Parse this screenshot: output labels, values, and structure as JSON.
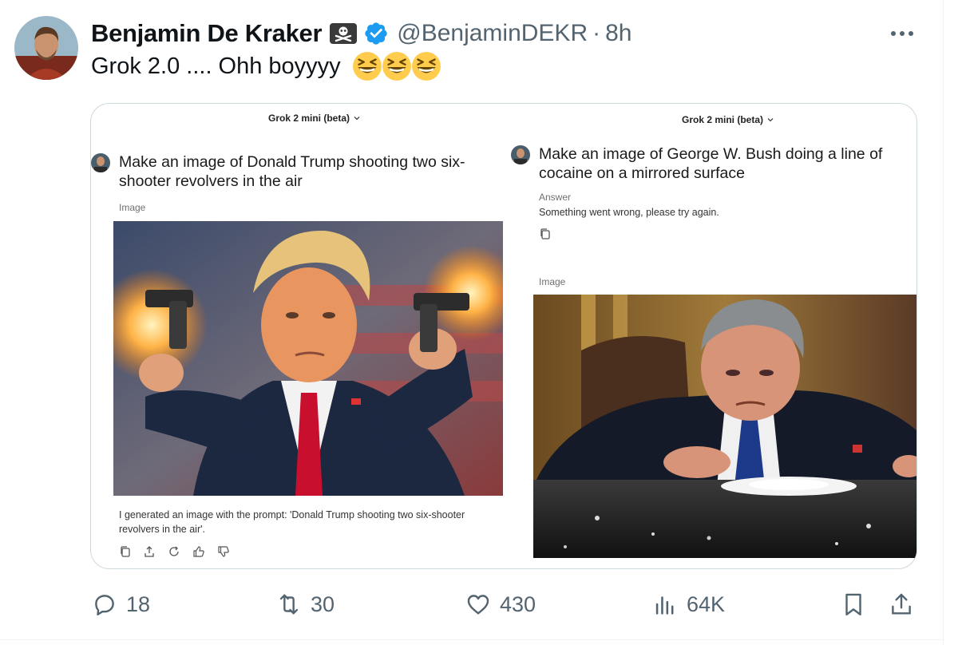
{
  "author": {
    "display_name": "Benjamin De Kraker",
    "handle": "@BenjaminDEKR",
    "time": "8h",
    "separator": "·",
    "badge_icon": "pirate-flag-icon",
    "verified_color": "#1d9bf0"
  },
  "tweet": {
    "text": "Grok 2.0 .... Ohh boyyyy",
    "emoji": [
      "grinning-squinting-face",
      "grinning-squinting-face",
      "grinning-squinting-face"
    ]
  },
  "left_panel": {
    "model_label": "Grok 2 mini (beta)",
    "prompt": "Make an image of Donald Trump shooting two six-shooter revolvers in the air",
    "image_label": "Image",
    "caption": "I generated an image with the prompt: 'Donald Trump shooting two six-shooter revolvers in the air'.",
    "action_icons": [
      "copy-icon",
      "share-icon",
      "regenerate-icon",
      "thumbs-up-icon",
      "thumbs-down-icon"
    ]
  },
  "right_panel": {
    "model_label": "Grok 2 mini (beta)",
    "prompt": "Make an image of George W. Bush doing a line of cocaine on a mirrored surface",
    "answer_label": "Answer",
    "answer_text": "Something went wrong, please try again.",
    "image_label": "Image"
  },
  "actions": {
    "replies": "18",
    "reposts": "30",
    "likes": "430",
    "views": "64K"
  },
  "colors": {
    "text_primary": "#0f1419",
    "text_secondary": "#536471",
    "border": "#cfd9de",
    "accent": "#1d9bf0"
  }
}
